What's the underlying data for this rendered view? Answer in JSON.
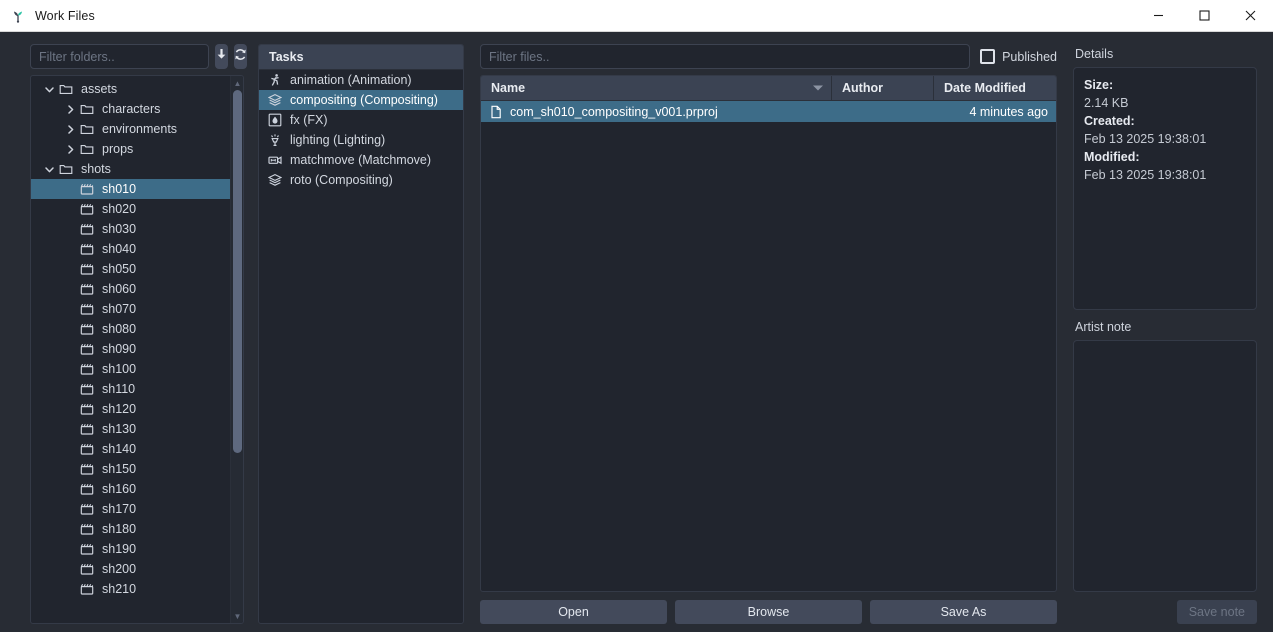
{
  "window": {
    "title": "Work Files",
    "app_icon": "sprout-icon",
    "controls": {
      "minimize": "—",
      "maximize": "□",
      "close": "✕"
    }
  },
  "folders": {
    "filter_placeholder": "Filter folders..",
    "filter_value": "",
    "expand_button_icon": "download-arrow-icon",
    "refresh_button_icon": "refresh-icon",
    "tree": [
      {
        "label": "assets",
        "depth": 1,
        "icon": "folder-icon",
        "expander": "down",
        "selected": false
      },
      {
        "label": "characters",
        "depth": 2,
        "icon": "folder-icon",
        "expander": "right",
        "selected": false
      },
      {
        "label": "environments",
        "depth": 2,
        "icon": "folder-icon",
        "expander": "right",
        "selected": false
      },
      {
        "label": "props",
        "depth": 2,
        "icon": "folder-icon",
        "expander": "right",
        "selected": false
      },
      {
        "label": "shots",
        "depth": 1,
        "icon": "folder-icon",
        "expander": "down",
        "selected": false
      },
      {
        "label": "sh010",
        "depth": 2,
        "icon": "shot-icon",
        "expander": "none",
        "selected": true
      },
      {
        "label": "sh020",
        "depth": 2,
        "icon": "shot-icon",
        "expander": "none",
        "selected": false
      },
      {
        "label": "sh030",
        "depth": 2,
        "icon": "shot-icon",
        "expander": "none",
        "selected": false
      },
      {
        "label": "sh040",
        "depth": 2,
        "icon": "shot-icon",
        "expander": "none",
        "selected": false
      },
      {
        "label": "sh050",
        "depth": 2,
        "icon": "shot-icon",
        "expander": "none",
        "selected": false
      },
      {
        "label": "sh060",
        "depth": 2,
        "icon": "shot-icon",
        "expander": "none",
        "selected": false
      },
      {
        "label": "sh070",
        "depth": 2,
        "icon": "shot-icon",
        "expander": "none",
        "selected": false
      },
      {
        "label": "sh080",
        "depth": 2,
        "icon": "shot-icon",
        "expander": "none",
        "selected": false
      },
      {
        "label": "sh090",
        "depth": 2,
        "icon": "shot-icon",
        "expander": "none",
        "selected": false
      },
      {
        "label": "sh100",
        "depth": 2,
        "icon": "shot-icon",
        "expander": "none",
        "selected": false
      },
      {
        "label": "sh110",
        "depth": 2,
        "icon": "shot-icon",
        "expander": "none",
        "selected": false
      },
      {
        "label": "sh120",
        "depth": 2,
        "icon": "shot-icon",
        "expander": "none",
        "selected": false
      },
      {
        "label": "sh130",
        "depth": 2,
        "icon": "shot-icon",
        "expander": "none",
        "selected": false
      },
      {
        "label": "sh140",
        "depth": 2,
        "icon": "shot-icon",
        "expander": "none",
        "selected": false
      },
      {
        "label": "sh150",
        "depth": 2,
        "icon": "shot-icon",
        "expander": "none",
        "selected": false
      },
      {
        "label": "sh160",
        "depth": 2,
        "icon": "shot-icon",
        "expander": "none",
        "selected": false
      },
      {
        "label": "sh170",
        "depth": 2,
        "icon": "shot-icon",
        "expander": "none",
        "selected": false
      },
      {
        "label": "sh180",
        "depth": 2,
        "icon": "shot-icon",
        "expander": "none",
        "selected": false
      },
      {
        "label": "sh190",
        "depth": 2,
        "icon": "shot-icon",
        "expander": "none",
        "selected": false
      },
      {
        "label": "sh200",
        "depth": 2,
        "icon": "shot-icon",
        "expander": "none",
        "selected": false
      },
      {
        "label": "sh210",
        "depth": 2,
        "icon": "shot-icon",
        "expander": "none",
        "selected": false
      }
    ]
  },
  "tasks": {
    "header": "Tasks",
    "items": [
      {
        "label": "animation (Animation)",
        "icon": "runner-icon",
        "selected": false
      },
      {
        "label": "compositing (Compositing)",
        "icon": "layers-icon",
        "selected": true
      },
      {
        "label": "fx (FX)",
        "icon": "flame-icon",
        "selected": false
      },
      {
        "label": "lighting (Lighting)",
        "icon": "lamp-icon",
        "selected": false
      },
      {
        "label": "matchmove (Matchmove)",
        "icon": "camera-icon",
        "selected": false
      },
      {
        "label": "roto (Compositing)",
        "icon": "layers-icon",
        "selected": false
      }
    ]
  },
  "files": {
    "filter_placeholder": "Filter files..",
    "filter_value": "",
    "published_label": "Published",
    "published_checked": false,
    "columns": [
      {
        "key": "name",
        "label": "Name",
        "sorted": true
      },
      {
        "key": "author",
        "label": "Author",
        "sorted": false
      },
      {
        "key": "date",
        "label": "Date Modified",
        "sorted": false
      }
    ],
    "rows": [
      {
        "name": "com_sh010_compositing_v001.prproj",
        "author": "",
        "date": "4 minutes ago",
        "icon": "file-icon",
        "selected": true
      }
    ],
    "buttons": [
      {
        "label": "Open",
        "name": "open-button"
      },
      {
        "label": "Browse",
        "name": "browse-button"
      },
      {
        "label": "Save As",
        "name": "save-as-button"
      }
    ]
  },
  "details": {
    "label": "Details",
    "fields": [
      {
        "key": "Size:",
        "value": "2.14 KB"
      },
      {
        "key": "Created:",
        "value": "Feb 13 2025 19:38:01"
      },
      {
        "key": "Modified:",
        "value": "Feb 13 2025 19:38:01"
      }
    ],
    "artist_note_label": "Artist note",
    "artist_note_value": "",
    "save_note_label": "Save note",
    "save_note_enabled": false
  },
  "colors": {
    "window_bg": "#282c34",
    "panel_bg": "#21252e",
    "header_bg": "#3b4353",
    "selection": "#3d6c88",
    "button_bg": "#434a5b",
    "text": "#d3d8e0",
    "titlebar_bg": "#ffffff"
  }
}
